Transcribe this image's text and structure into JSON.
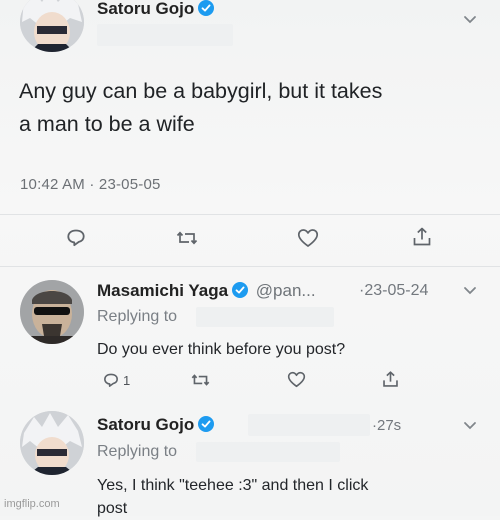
{
  "tweet": {
    "author_name": "Satoru Gojo",
    "text_line1": "Any guy can be a babygirl, but it takes",
    "text_line2": "a man to be a wife",
    "timestamp": "10:42 AM · 23-05-05"
  },
  "reply1": {
    "author_name": "Masamichi Yaga",
    "handle": "@pan...",
    "date": "·23-05-24",
    "replying_to": "Replying to",
    "text": "Do you ever think before you post?",
    "reply_count": "1"
  },
  "reply2": {
    "author_name": "Satoru Gojo",
    "time": "·27s",
    "replying_to": "Replying to",
    "text_line1": "Yes, I think \"teehee :3\" and then I click",
    "text_line2": "post"
  },
  "watermark": "imgflip.com",
  "colors": {
    "verified": "#1d9bf0",
    "text": "#202326",
    "muted": "#6f7479",
    "background": "#f4f5f5"
  },
  "icons": [
    "reply-icon",
    "retweet-icon",
    "like-icon",
    "share-icon",
    "verified-badge-icon",
    "chevron-down-icon"
  ]
}
